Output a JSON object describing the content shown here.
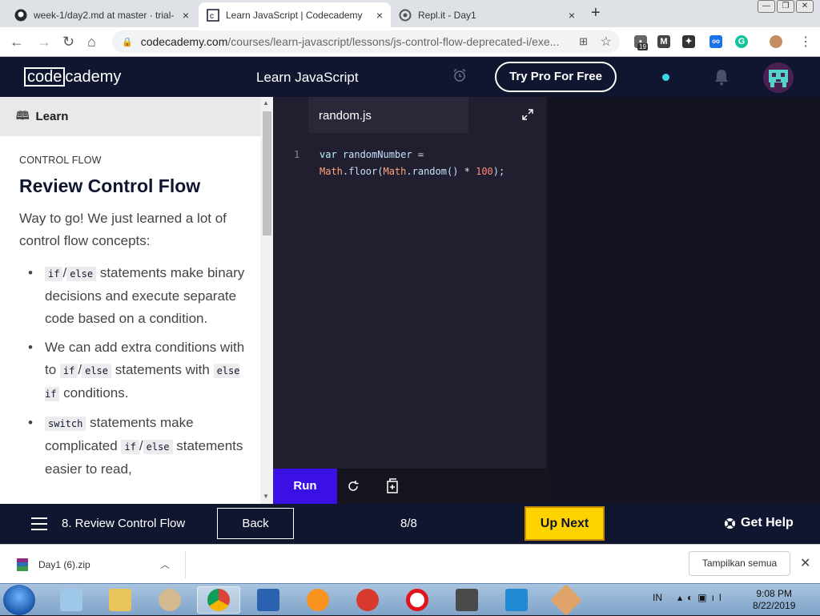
{
  "browser": {
    "tabs": [
      {
        "title": "week-1/day2.md at master · trial-",
        "close": "×"
      },
      {
        "title": "Learn JavaScript | Codecademy",
        "close": "×"
      },
      {
        "title": "Repl.it - Day1",
        "close": "×"
      }
    ],
    "new_tab": "+",
    "url_host": "codecademy.com",
    "url_path": "/courses/learn-javascript/lessons/js-control-flow-deprecated-i/exe...",
    "extension_badge": "19"
  },
  "header": {
    "logo_left": "code",
    "logo_right": "cademy",
    "course_title": "Learn JavaScript",
    "pro_button": "Try Pro For Free"
  },
  "lesson": {
    "learn_tab": "Learn",
    "kicker": "CONTROL FLOW",
    "title": "Review Control Flow",
    "intro": "Way to go! We just learned a lot of control flow concepts:",
    "points": [
      {
        "code1": "if",
        "sep": "/",
        "code2": "else",
        "text": " statements make binary decisions and execute separate code based on a condition."
      },
      {
        "pre": "We can add extra conditions with to ",
        "code1": "if",
        "sep": "/",
        "code2": "else",
        "mid": " statements with ",
        "code3": "else if",
        "post": " conditions."
      },
      {
        "code0": "switch",
        "pre": " statements make complicated ",
        "code1": "if",
        "sep": "/",
        "code2": "else",
        "post": " statements easier to read,"
      }
    ]
  },
  "editor": {
    "filename": "random.js",
    "line_number": "1",
    "code": {
      "t1": "var",
      "t2": " randomNumber ",
      "t3": "=",
      "t4": "Math",
      "t5": ".floor(",
      "t6": "Math",
      "t7": ".random() ",
      "t8": "*",
      "t9": " ",
      "t10": "100",
      "t11": ");"
    },
    "run_button": "Run"
  },
  "lesson_nav": {
    "lesson_name": "8. Review Control Flow",
    "back_button": "Back",
    "progress": "8/8",
    "next_button": "Up Next",
    "help": "Get Help"
  },
  "downloads": {
    "file": "Day1 (6).zip",
    "show_all": "Tampilkan semua",
    "close": "✕"
  },
  "taskbar": {
    "language": "IN",
    "time": "9:08 PM",
    "date": "8/22/2019"
  },
  "colors": {
    "codecademy_navy": "#10162f",
    "run_blue": "#3a10e5",
    "up_next_yellow": "#ffd300",
    "editor_bg": "#211e2f"
  }
}
